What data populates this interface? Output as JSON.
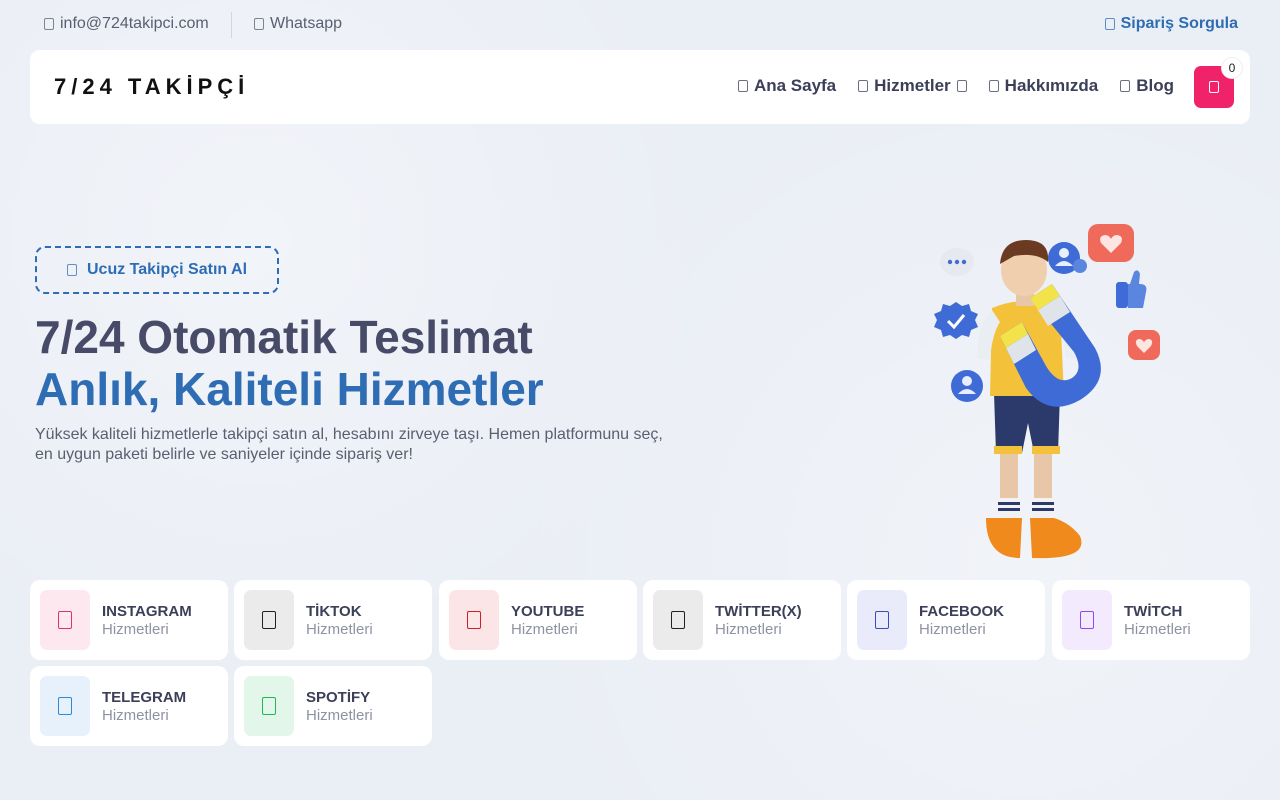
{
  "topbar": {
    "email": "info@724takipci.com",
    "whatsapp": "Whatsapp",
    "order_query": "Sipariş Sorgula"
  },
  "navbar": {
    "logo": "7/24 TAKİPÇİ",
    "items": [
      {
        "label": "Ana Sayfa",
        "icon": "home-icon"
      },
      {
        "label": "Hizmetler",
        "icon": "grid-icon"
      },
      {
        "label": "Hakkımızda",
        "icon": "info-icon"
      },
      {
        "label": "Blog",
        "icon": "blog-icon"
      }
    ],
    "cart_count": "0"
  },
  "hero": {
    "badge": "Ucuz Takipçi Satın Al",
    "headline_line1": "7/24 Otomatik Teslimat",
    "headline_line2": "Anlık, Kaliteli Hizmetler",
    "description": "Yüksek kaliteli hizmetlerle takipçi satın al, hesabını zirveye taşı. Hemen platformunu seç, en uygun paketi belirle ve saniyeler içinde sipariş ver!"
  },
  "services": [
    {
      "name": "INSTAGRAM",
      "sub": "Hizmetleri",
      "color": "#e1306c",
      "bg": "#fde8ef"
    },
    {
      "name": "TİKTOK",
      "sub": "Hizmetleri",
      "color": "#222222",
      "bg": "#ebebeb"
    },
    {
      "name": "YOUTUBE",
      "sub": "Hizmetleri",
      "color": "#cc1f2a",
      "bg": "#fbe5e6"
    },
    {
      "name": "TWİTTER(X)",
      "sub": "Hizmetleri",
      "color": "#222222",
      "bg": "#ebebeb"
    },
    {
      "name": "FACEBOOK",
      "sub": "Hizmetleri",
      "color": "#3b4bbd",
      "bg": "#e9ebfa"
    },
    {
      "name": "TWİTCH",
      "sub": "Hizmetleri",
      "color": "#9146ff",
      "bg": "#f3ebfd"
    },
    {
      "name": "TELEGRAM",
      "sub": "Hizmetleri",
      "color": "#2a8bd6",
      "bg": "#e7f1fb"
    },
    {
      "name": "SPOTİFY",
      "sub": "Hizmetleri",
      "color": "#1db954",
      "bg": "#e3f6ea"
    }
  ],
  "colors": {
    "accent": "#2e6db4",
    "cart": "#f0226a",
    "heading": "#474b68"
  }
}
